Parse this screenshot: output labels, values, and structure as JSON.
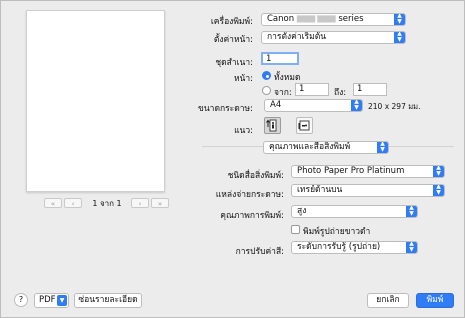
{
  "preview": {
    "page_indicator": "1 จาก 1"
  },
  "printer": {
    "label": "เครื่องพิมพ์:",
    "name": "Canon",
    "model_blur": "████ ████",
    "series": "series"
  },
  "presets": {
    "label": "ตั้งค่าหน้า:",
    "value": "การตั้งค่าเริ่มต้น"
  },
  "copies": {
    "label": "ชุดสำเนา:",
    "value": "1"
  },
  "pages": {
    "label": "หน้า:",
    "all_label": "ทั้งหมด",
    "from_label": "จาก:",
    "from_value": "1",
    "to_label": "ถึง:",
    "to_value": "1"
  },
  "paper_size": {
    "label": "ขนาดกระดาษ:",
    "value": "A4",
    "dimensions": "210 x 297 มม."
  },
  "orientation": {
    "label": "แนว:",
    "portrait_icon": "portrait-icon",
    "landscape_icon": "landscape-icon"
  },
  "panel": {
    "value": "คุณภาพและสื่อสิ่งพิมพ์"
  },
  "media_type": {
    "label": "ชนิดสื่อสิ่งพิมพ์:",
    "value": "Photo Paper Pro Platinum"
  },
  "paper_source": {
    "label": "แหล่งจ่ายกระดาษ:",
    "value": "เทรย์ด้านบน"
  },
  "print_quality": {
    "label": "คุณภาพการพิมพ์:",
    "value": "สูง"
  },
  "grayscale": {
    "label": "พิมพ์รูปถ่ายขาวดำ",
    "checked": false
  },
  "color_adjust": {
    "label": "การปรับค่าสี:",
    "value": "ระดับการรับรู้ (รูปถ่าย)"
  },
  "footer": {
    "help": "?",
    "pdf_label": "PDF",
    "details_label": "ซ่อนรายละเอียด",
    "cancel_label": "ยกเลิก",
    "print_label": "พิมพ์"
  },
  "colors": {
    "accent": "#2f7cf6",
    "background": "#ececec"
  }
}
